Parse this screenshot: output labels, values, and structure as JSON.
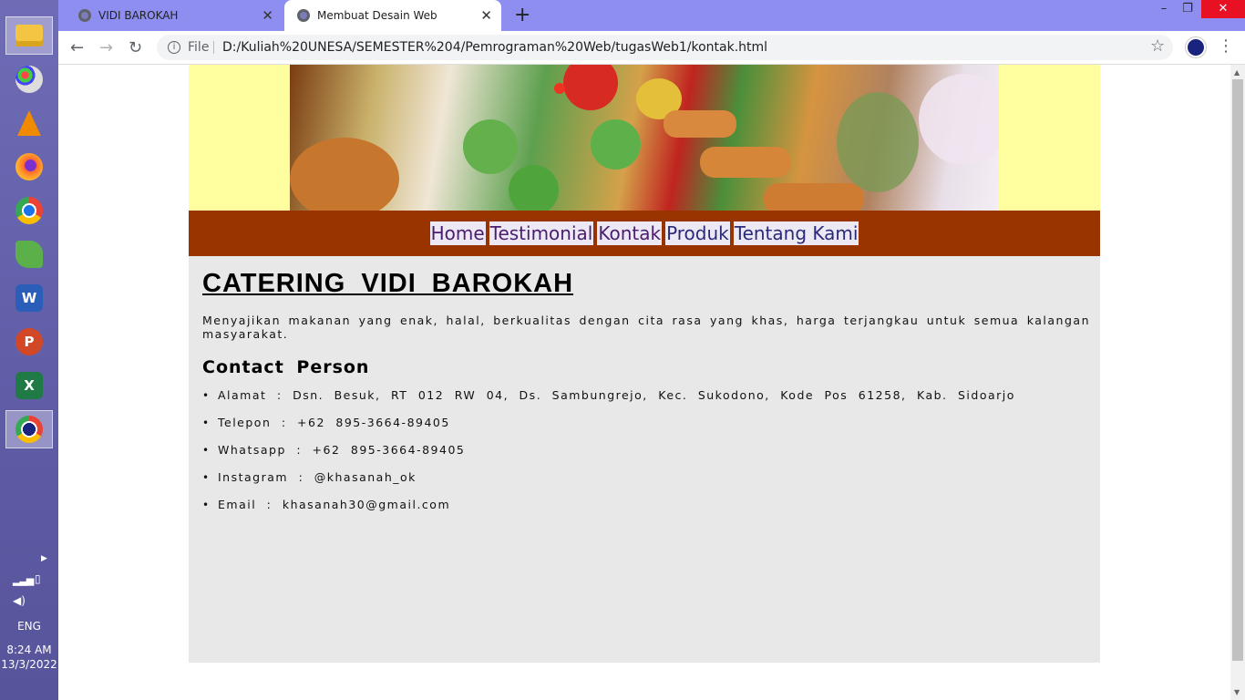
{
  "taskbar": {
    "apps": [
      {
        "name": "file-explorer-icon",
        "label": ""
      },
      {
        "name": "paint-icon",
        "label": ""
      },
      {
        "name": "vlc-icon",
        "label": ""
      },
      {
        "name": "firefox-icon",
        "label": ""
      },
      {
        "name": "chrome-icon",
        "label": ""
      },
      {
        "name": "green-app-icon",
        "label": ""
      },
      {
        "name": "word-icon",
        "label": "W"
      },
      {
        "name": "powerpoint-icon",
        "label": "P"
      },
      {
        "name": "excel-icon",
        "label": "X"
      },
      {
        "name": "chrome-profile-icon",
        "label": ""
      }
    ],
    "tray": {
      "language": "ENG",
      "time": "8:24 AM",
      "date": "13/3/2022"
    }
  },
  "browser": {
    "tabs": [
      {
        "title": "VIDI BAROKAH",
        "active": false
      },
      {
        "title": "Membuat Desain Web",
        "active": true
      }
    ],
    "new_tab": "+",
    "controls": {
      "minimize": "–",
      "restore": "❐",
      "close": "✕"
    },
    "address": {
      "info": "i",
      "scheme_label": "File",
      "url": "D:/Kuliah%20UNESA/SEMESTER%204/Pemrograman%20Web/tugasWeb1/kontak.html"
    }
  },
  "colors": {
    "banner_bg": "#ffffa0",
    "nav_bg": "#993300",
    "content_bg": "#e8e8e8",
    "tab_strip": "#8e8ef0"
  },
  "page": {
    "nav": [
      {
        "label": "Home",
        "visited": true
      },
      {
        "label": "Testimonial",
        "visited": true
      },
      {
        "label": "Kontak",
        "visited": true
      },
      {
        "label": "Produk",
        "visited": false
      },
      {
        "label": "Tentang Kami",
        "visited": false
      }
    ],
    "heading": "CATERING VIDI BAROKAH",
    "tagline": "Menyajikan makanan yang enak, halal, berkualitas dengan cita rasa yang khas, harga terjangkau untuk semua kalangan masyarakat.",
    "contact_title": "Contact Person",
    "contacts": [
      "Alamat : Dsn. Besuk, RT 012 RW 04, Ds. Sambungrejo, Kec. Sukodono, Kode Pos 61258, Kab. Sidoarjo",
      "Telepon : +62 895-3664-89405",
      "Whatsapp : +62 895-3664-89405",
      "Instagram : @khasanah_ok",
      "Email : khasanah30@gmail.com"
    ]
  }
}
